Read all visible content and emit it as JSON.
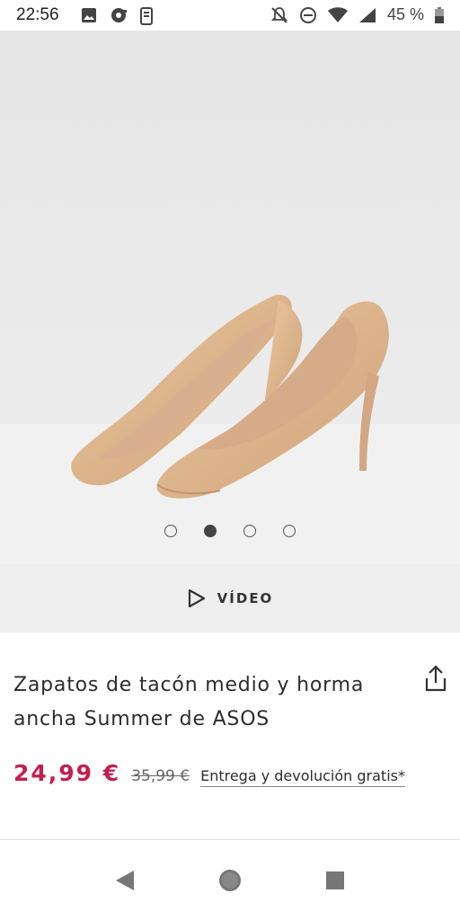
{
  "status_bar": {
    "time": "22:56",
    "battery_text": "45 %"
  },
  "carousel": {
    "total": 4,
    "active_index": 1
  },
  "video": {
    "label": "VÍDEO"
  },
  "product": {
    "title": "Zapatos de tacón medio y horma ancha Summer de ASOS",
    "price_now": "24,99 €",
    "price_old": "35,99 €",
    "delivery_link": "Entrega y devolución gratis*"
  },
  "colors": {
    "price_accent": "#c41f4f",
    "hero_bg": "#e9e9e9"
  },
  "icons": [
    "image-icon",
    "cast-icon",
    "phone-icon",
    "mute-icon",
    "dnd-icon",
    "wifi-icon",
    "signal-icon",
    "battery-icon",
    "play-icon",
    "share-icon",
    "back-icon",
    "home-icon",
    "recents-icon"
  ]
}
